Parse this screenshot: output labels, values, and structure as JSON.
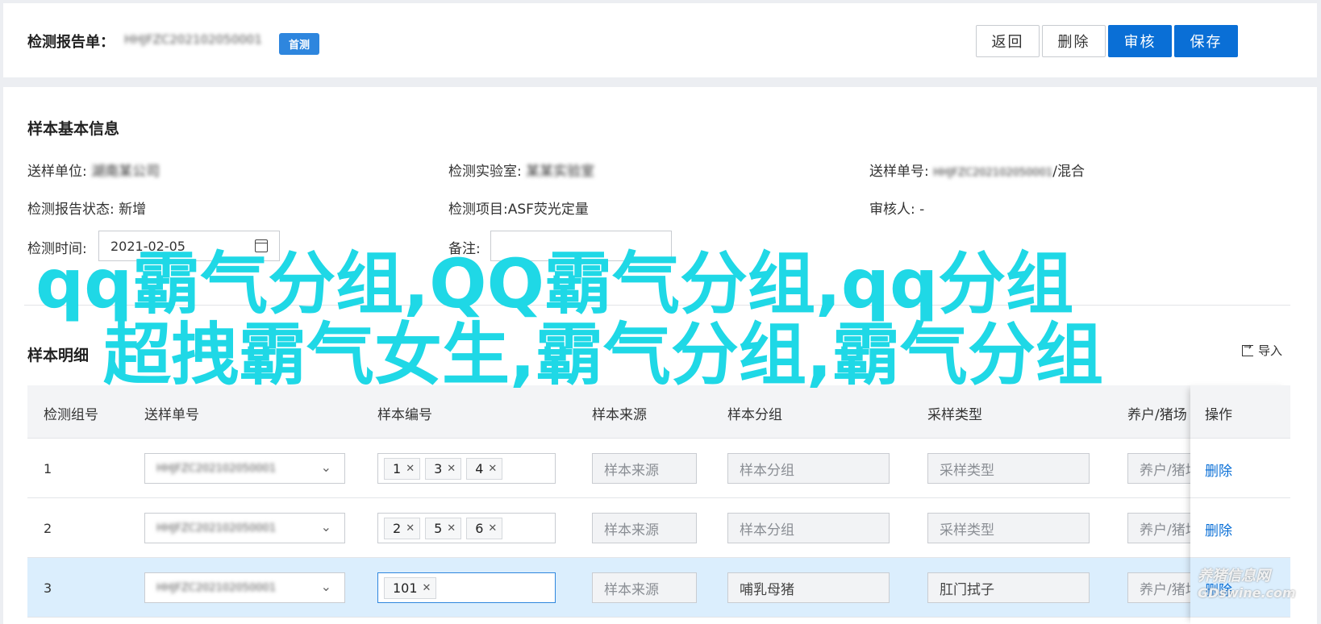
{
  "header": {
    "title": "检测报告单：",
    "report_id": "HHJFZC202102050001",
    "badge": "首测",
    "buttons": {
      "back": "返回",
      "delete": "删除",
      "audit": "审核",
      "save": "保存"
    }
  },
  "basic_info": {
    "title": "样本基本信息",
    "fields": {
      "sender_unit_label": "送样单位:",
      "sender_unit_value": "湖南某公司",
      "lab_label": "检测实验室:",
      "lab_value": "某某实验室",
      "order_no_label": "送样单号:",
      "order_no_value": "HHJFZC202102050001",
      "order_no_suffix": "/混合",
      "status_label": "检测报告状态:",
      "status_value": "新增",
      "item_label": "检测项目:",
      "item_value": "ASF荧光定量",
      "auditor_label": "审核人:",
      "auditor_value": "-",
      "time_label": "检测时间:",
      "time_value": "2021-02-05",
      "remark_label": "备注:",
      "remark_value": ""
    }
  },
  "details": {
    "title": "样本明细",
    "import_label": "导入",
    "columns": [
      "检测组号",
      "送样单号",
      "样本编号",
      "样本来源",
      "样本分组",
      "采样类型",
      "养户/猪场",
      "操作"
    ],
    "rows": [
      {
        "num": "1",
        "order": "HHJFZC202102050001",
        "tags": [
          "1",
          "3",
          "4"
        ],
        "source": "样本来源",
        "group": "样本分组",
        "type": "采样类型",
        "farm": "养户/猪场",
        "action": "删除"
      },
      {
        "num": "2",
        "order": "HHJFZC202102050001",
        "tags": [
          "2",
          "5",
          "6"
        ],
        "source": "样本来源",
        "group": "样本分组",
        "type": "采样类型",
        "farm": "养户/猪场",
        "action": "删除"
      },
      {
        "num": "3",
        "order": "HHJFZC202102050001",
        "tags": [
          "101"
        ],
        "source": "样本来源",
        "group": "哺乳母猪",
        "type": "肛门拭子",
        "farm": "养户/猪场",
        "action": "删除"
      }
    ]
  },
  "overlay": {
    "line1": "qq霸气分组,QQ霸气分组,qq分组",
    "line2": "超拽霸气女生,霸气分组,霸气分组"
  },
  "watermark": {
    "line1": "养猪信息网",
    "line2": "GDswine.com"
  },
  "colors": {
    "primary": "#0a6fd6",
    "badge": "#2e86de",
    "overlay": "#1fd8e6",
    "selected_row": "#dbeefd"
  }
}
